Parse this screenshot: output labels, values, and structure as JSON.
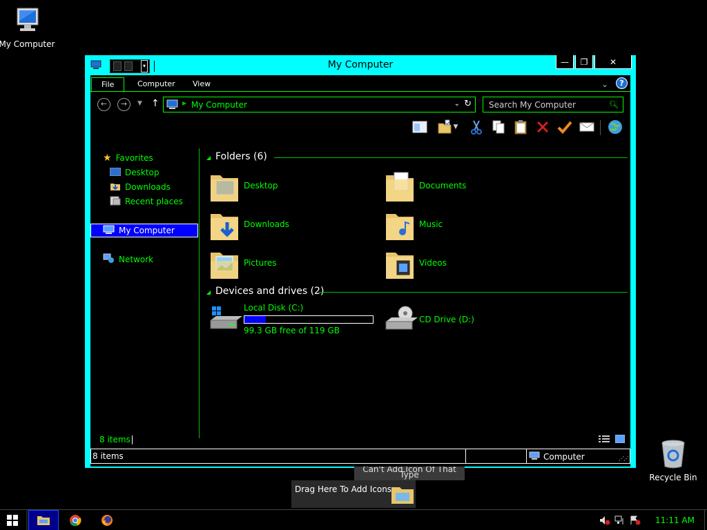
{
  "desktop": {
    "my_computer_label": "My Computer",
    "recycle_bin_label": "Recycle Bin"
  },
  "window": {
    "title": "My Computer",
    "controls": {
      "minimize": "—",
      "maximize": "❐",
      "close": "✕"
    },
    "tabs": [
      "File",
      "Computer",
      "View"
    ],
    "help_label": "?",
    "address": {
      "crumb": "My Computer"
    },
    "search_placeholder": "Search My Computer",
    "toolbar_icons": [
      "preview-pane-icon",
      "new-folder-icon",
      "cut-icon",
      "copy-icon",
      "paste-icon",
      "delete-icon",
      "check-icon",
      "mail-icon",
      "globe-icon"
    ]
  },
  "nav_pane": {
    "favorites": "Favorites",
    "desktop": "Desktop",
    "downloads": "Downloads",
    "recent": "Recent places",
    "my_computer": "My Computer",
    "network": "Network"
  },
  "content": {
    "folders_header": "Folders (6)",
    "folders": [
      "Desktop",
      "Documents",
      "Downloads",
      "Music",
      "Pictures",
      "Videos"
    ],
    "devices_header": "Devices and drives (2)",
    "local_disk": {
      "name": "Local Disk (C:)",
      "free_text": "99.3 GB free of 119 GB",
      "used_fraction": 0.166
    },
    "cd_drive": "CD Drive (D:)"
  },
  "details": {
    "count": "8 items"
  },
  "statusbar": {
    "count": "8 items",
    "location": "Computer"
  },
  "tooltips": {
    "cant_add": "Can't Add Icon Of That Type",
    "drag_here": "Drag Here To Add Icons"
  },
  "taskbar": {
    "clock": "11:11 AM"
  },
  "colors": {
    "window_frame": "#00ffff",
    "accent_text": "#00ff00",
    "selection": "#0000ff"
  }
}
